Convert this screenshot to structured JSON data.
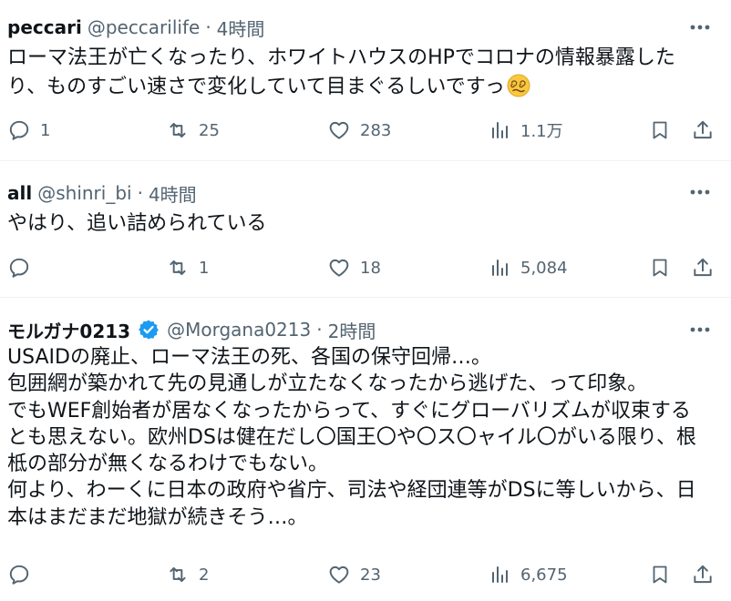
{
  "colors": {
    "text_primary": "#0f1419",
    "text_secondary": "#536471",
    "verified_blue": "#1d9bf0",
    "divider": "#eff3f4"
  },
  "tweets": [
    {
      "name": "peccari",
      "handle": "@peccarilife",
      "separator": "·",
      "time": "4時間",
      "lines": [
        "ローマ法王が亡くなったり、ホワイトハウスのHPでコロナの情報暴露した",
        "り、ものすごい速さで変化していて目まぐるしいですっ"
      ],
      "emoji": "face-with-spiral-eyes",
      "replies": "1",
      "reposts": "25",
      "likes": "283",
      "views": "1.1万",
      "verified": false
    },
    {
      "name": "all",
      "handle": "@shinri_bi",
      "separator": "·",
      "time": "4時間",
      "lines": [
        "やはり、追い詰められている"
      ],
      "replies": "",
      "reposts": "1",
      "likes": "18",
      "views": "5,084",
      "verified": false
    },
    {
      "name": "モルガナ0213",
      "handle": "@Morgana0213",
      "separator": "·",
      "time": "2時間",
      "lines": [
        "USAIDの廃止、ローマ法王の死、各国の保守回帰…。",
        "包囲網が築かれて先の見通しが立たなくなったから逃げた、って印象。",
        "でもWEF創始者が居なくなったからって、すぐにグローバリズムが収束する",
        "とも思えない。欧州DSは健在だし〇国王〇や〇ス〇ャイル〇がいる限り、根",
        "柢の部分が無くなるわけでもない。",
        "何より、わーくに日本の政府や省庁、司法や経団連等がDSに等しいから、日",
        "本はまだまだ地獄が続きそう…。"
      ],
      "replies": "",
      "reposts": "2",
      "likes": "23",
      "views": "6,675",
      "verified": true
    }
  ]
}
